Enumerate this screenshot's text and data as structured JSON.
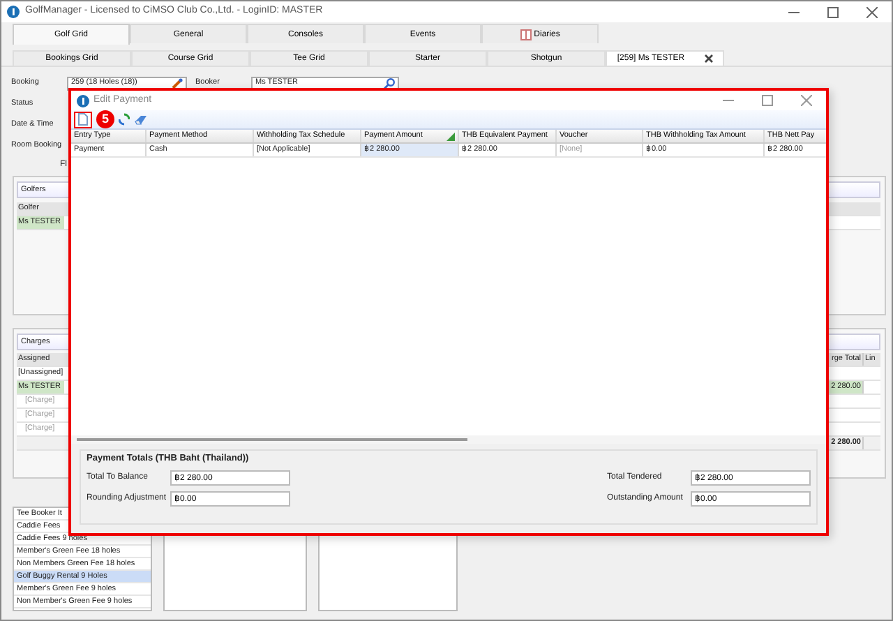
{
  "app": {
    "title": "GolfManager - Licensed to CiMSO Club Co.,Ltd. - LoginID: MASTER"
  },
  "main_tabs": [
    {
      "label": "Golf Grid",
      "selected": true,
      "kind": "text"
    },
    {
      "label": "General",
      "selected": false,
      "kind": "text"
    },
    {
      "label": "Consoles",
      "selected": false,
      "kind": "text"
    },
    {
      "label": "Events",
      "selected": false,
      "kind": "text"
    },
    {
      "label": "Diaries",
      "selected": false,
      "kind": "icon"
    }
  ],
  "sub_tabs": [
    {
      "label": "Bookings Grid",
      "selected": false,
      "closable": false
    },
    {
      "label": "Course Grid",
      "selected": false,
      "closable": false
    },
    {
      "label": "Tee Grid",
      "selected": false,
      "closable": false
    },
    {
      "label": "Starter",
      "selected": false,
      "closable": false
    },
    {
      "label": "Shotgun",
      "selected": false,
      "closable": false
    },
    {
      "label": "[259] Ms TESTER",
      "selected": true,
      "closable": true
    }
  ],
  "booking_form": {
    "booking": {
      "label": "Booking",
      "value": "259 (18 Holes (18))"
    },
    "booker": {
      "label": "Booker",
      "value": "Ms TESTER"
    },
    "labels": [
      "Status",
      "Date & Time",
      "Room Booking"
    ],
    "section_label": "Fl"
  },
  "golfers": {
    "title": "Golfers",
    "column": "Golfer",
    "rows": [
      {
        "text": "Ms TESTER",
        "selected": true
      }
    ]
  },
  "charges": {
    "title": "Charges",
    "column": "Assigned",
    "right_columns": [
      "rge Total",
      "Lin"
    ],
    "rows": [
      {
        "text": "[Unassigned]",
        "selected": false
      },
      {
        "text": "Ms TESTER",
        "selected": true,
        "total": "2 280.00",
        "children": [
          {
            "text": "[Charge]"
          },
          {
            "text": "[Charge]"
          },
          {
            "text": "[Charge]"
          }
        ]
      }
    ],
    "grand_total": "2 280.00"
  },
  "tee_booker_items": {
    "column": "Tee Booker It",
    "items": [
      {
        "text": "Caddie Fees",
        "selected": false
      },
      {
        "text": "Caddie Fees 9 holes",
        "selected": false
      },
      {
        "text": "Member's Green Fee 18 holes",
        "selected": false
      },
      {
        "text": "Non Members Green Fee 18 holes",
        "selected": false
      },
      {
        "text": "Golf Buggy Rental 9 Holes",
        "selected": true
      },
      {
        "text": "Member's Green Fee 9 holes",
        "selected": false
      },
      {
        "text": "Non Member's Green Fee 9 holes",
        "selected": false
      }
    ]
  },
  "dialog": {
    "title": "Edit Payment",
    "step_badge": "5",
    "columns": [
      "Entry Type",
      "Payment Method",
      "Withholding Tax Schedule",
      "Payment Amount",
      "THB Equivalent Payment",
      "Voucher",
      "THB Withholding Tax Amount",
      "THB Nett Pay"
    ],
    "rows": [
      {
        "cells": [
          {
            "text": "Payment",
            "selected": false,
            "dimmed": false
          },
          {
            "text": "Cash",
            "selected": false,
            "dimmed": false
          },
          {
            "text": "[Not Applicable]",
            "selected": false,
            "dimmed": false
          },
          {
            "text": "฿2 280.00",
            "selected": true,
            "dimmed": false
          },
          {
            "text": "฿2 280.00",
            "selected": false,
            "dimmed": false
          },
          {
            "text": "[None]",
            "selected": false,
            "dimmed": true
          },
          {
            "text": "฿0.00",
            "selected": false,
            "dimmed": false
          },
          {
            "text": "฿2 280.00",
            "selected": false,
            "dimmed": false
          }
        ]
      }
    ],
    "totals": {
      "title": "Payment Totals (THB Baht (Thailand))",
      "fields": [
        {
          "label": "Total To Balance",
          "value": "฿2 280.00"
        },
        {
          "label": "Total Tendered",
          "value": "฿2 280.00"
        },
        {
          "label": "Rounding Adjustment",
          "value": "฿0.00"
        },
        {
          "label": "Outstanding Amount",
          "value": "฿0.00"
        }
      ]
    }
  }
}
